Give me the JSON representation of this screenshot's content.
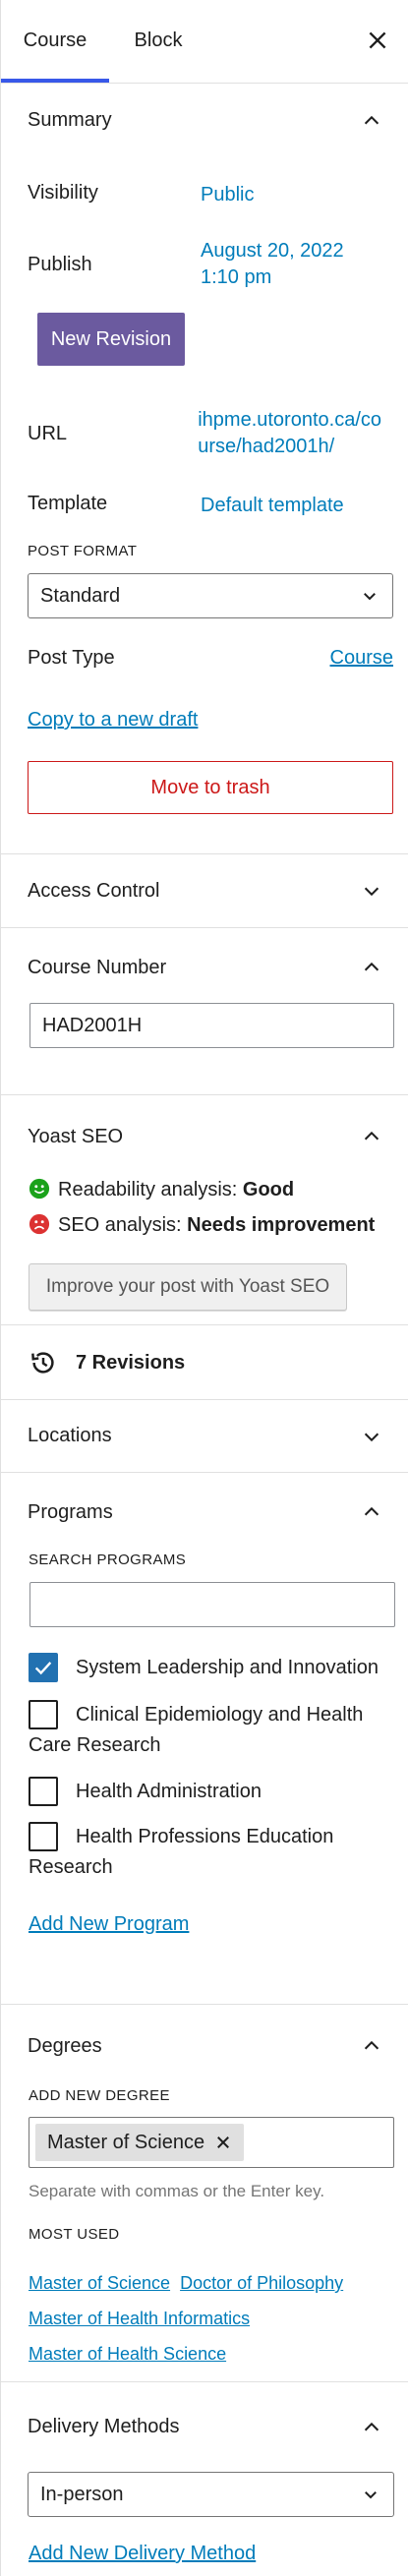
{
  "tabs": {
    "course": "Course",
    "block": "Block"
  },
  "summary": {
    "title": "Summary",
    "visibility_label": "Visibility",
    "visibility_value": "Public",
    "publish_label": "Publish",
    "publish_date": "August 20, 2022",
    "publish_time": "1:10 pm",
    "new_revision": "New Revision",
    "url_label": "URL",
    "url_line1": "ihpme.utoronto.ca/co",
    "url_line2": "urse/had2001h/",
    "template_label": "Template",
    "template_value": "Default template",
    "post_format_label": "POST FORMAT",
    "post_format_value": "Standard",
    "post_type_label": "Post Type",
    "post_type_value": "Course",
    "copy_draft": "Copy to a new draft",
    "move_trash": "Move to trash"
  },
  "access_control": {
    "title": "Access Control"
  },
  "course_number": {
    "title": "Course Number",
    "value": "HAD2001H"
  },
  "yoast": {
    "title": "Yoast SEO",
    "readability_label": "Readability analysis:",
    "readability_value": "Good",
    "seo_label": "SEO analysis:",
    "seo_value": "Needs improvement",
    "improve_button": "Improve your post with Yoast SEO"
  },
  "revisions": {
    "label": "7 Revisions"
  },
  "locations": {
    "title": "Locations"
  },
  "programs": {
    "title": "Programs",
    "search_label": "SEARCH PROGRAMS",
    "search_value": "",
    "items": [
      {
        "label": "System Leadership and Innovation",
        "checked": true
      },
      {
        "label": "Clinical Epidemiology and Health Care Research",
        "checked": false
      },
      {
        "label": "Health Administration",
        "checked": false
      },
      {
        "label": "Health Professions Education Research",
        "checked": false
      }
    ],
    "add_new": "Add New Program"
  },
  "degrees": {
    "title": "Degrees",
    "add_label": "ADD NEW DEGREE",
    "token": "Master of Science",
    "help": "Separate with commas or the Enter key.",
    "most_used_label": "MOST USED",
    "most_used": [
      "Master of Science",
      "Doctor of Philosophy",
      "Master of Health Informatics",
      "Master of Health Science"
    ]
  },
  "delivery": {
    "title": "Delivery Methods",
    "value": "In-person",
    "add_new": "Add New Delivery Method"
  },
  "colors": {
    "link": "#007cba",
    "primary_button": "#6b5a9f",
    "danger": "#cc1818",
    "checkbox": "#2271b1",
    "good": "#1ba21b",
    "bad": "#dc3232"
  }
}
